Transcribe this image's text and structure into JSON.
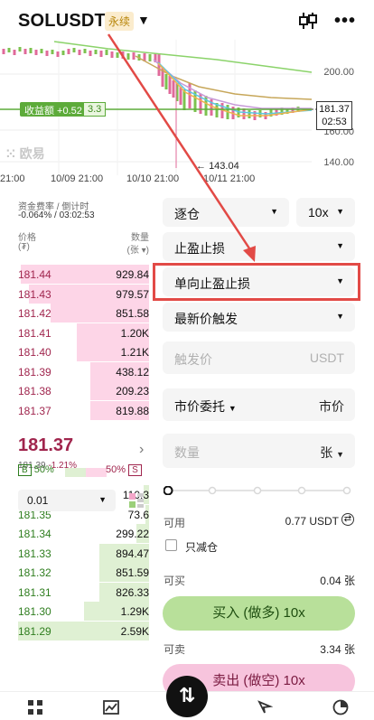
{
  "header": {
    "symbol": "SOLUSDT",
    "perp_badge": "永续"
  },
  "chart": {
    "y_labels": [
      "200.00",
      "160.00",
      "140.00"
    ],
    "x_labels": [
      "21:00",
      "10/09 21:00",
      "10/10 21:00",
      "10/11 21:00"
    ],
    "pnl_label": "收益额 +0.52",
    "pnl_leverage": "3.3",
    "price_tag_price": "181.37",
    "price_tag_time": "02:53",
    "low_label": "143.04",
    "watermark": "欧易"
  },
  "orderbook": {
    "funding_label": "资金费率 / 倒计时",
    "funding_value": "-0.064% / 03:02:53",
    "price_header": "价格",
    "price_unit": "(₮)",
    "qty_header": "数量",
    "qty_unit": "(张 ▾)",
    "asks": [
      {
        "price": "181.44",
        "qty": "929.84",
        "depth": 0.98
      },
      {
        "price": "181.43",
        "qty": "979.57",
        "depth": 0.92
      },
      {
        "price": "181.42",
        "qty": "851.58",
        "depth": 0.75
      },
      {
        "price": "181.41",
        "qty": "1.20K",
        "depth": 0.55
      },
      {
        "price": "181.40",
        "qty": "1.21K",
        "depth": 0.55
      },
      {
        "price": "181.39",
        "qty": "438.12",
        "depth": 0.45
      },
      {
        "price": "181.38",
        "qty": "209.23",
        "depth": 0.45
      },
      {
        "price": "181.37",
        "qty": "819.88",
        "depth": 0.45
      }
    ],
    "last_price": "181.37",
    "mark_price": "181.39",
    "change": "-1.21%",
    "bids": [
      {
        "price": "181.36",
        "qty": "110.3",
        "depth": 0.04
      },
      {
        "price": "181.35",
        "qty": "73.6",
        "depth": 0.03
      },
      {
        "price": "181.34",
        "qty": "299.22",
        "depth": 0.1
      },
      {
        "price": "181.33",
        "qty": "894.47",
        "depth": 0.38
      },
      {
        "price": "181.32",
        "qty": "851.59",
        "depth": 0.38
      },
      {
        "price": "181.31",
        "qty": "826.33",
        "depth": 0.38
      },
      {
        "price": "181.30",
        "qty": "1.29K",
        "depth": 0.5
      },
      {
        "price": "181.29",
        "qty": "2.59K",
        "depth": 1.0
      }
    ],
    "buy_tag": "B",
    "buy_ratio": "50%",
    "sell_ratio": "50%",
    "sell_tag": "S",
    "tick_size": "0.01"
  },
  "order_form": {
    "margin_mode": "逐仓",
    "leverage": "10x",
    "tp_sl": "止盈止损",
    "tp_sl_type": "单向止盈止损",
    "trigger_type": "最新价触发",
    "trigger_price_placeholder": "触发价",
    "trigger_price_unit": "USDT",
    "order_type": "市价委托",
    "order_price": "市价",
    "qty_placeholder": "数量",
    "qty_unit": "张",
    "available_label": "可用",
    "available_value": "0.77 USDT",
    "reduce_only": "只减仓",
    "can_buy_label": "可买",
    "can_buy_value": "0.04 张",
    "buy_button": "买入 (做多) 10x",
    "can_sell_label": "可卖",
    "can_sell_value": "3.34 张",
    "sell_button": "卖出 (做空) 10x",
    "slider_value": 0
  },
  "colors": {
    "ask": "#a0254d",
    "bid": "#2e7d1e",
    "highlight": "#e24a46",
    "buy": "#b8e09a",
    "sell": "#f7c4dd"
  }
}
